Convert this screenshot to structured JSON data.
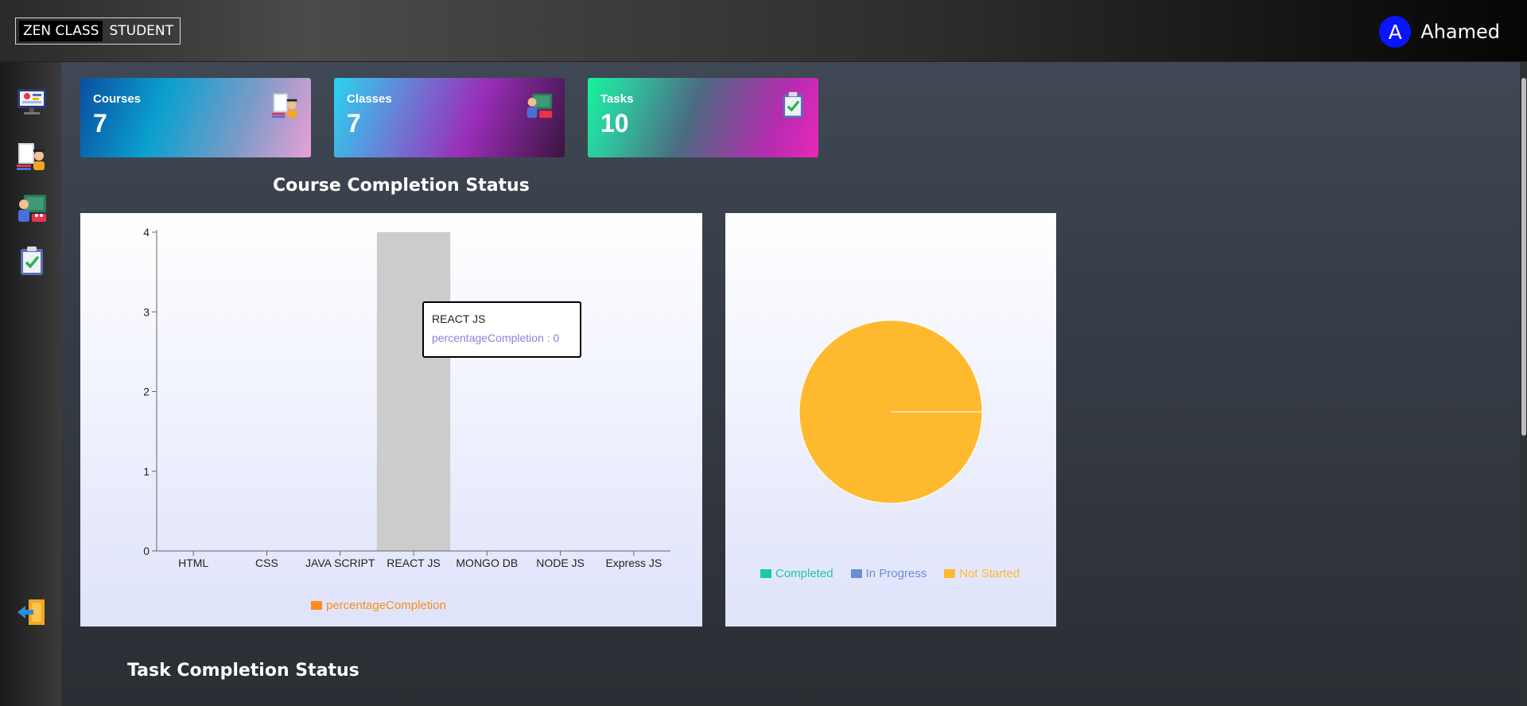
{
  "header": {
    "logo_part1": "ZEN CLASS",
    "logo_part2": "STUDENT",
    "avatar_letter": "A",
    "username": "Ahamed",
    "avatar_color": "#0a14ff"
  },
  "sidebar": {
    "items": [
      {
        "name": "dashboard",
        "icon": "dashboard-monitor-icon"
      },
      {
        "name": "courses",
        "icon": "books-student-icon"
      },
      {
        "name": "classes",
        "icon": "teacher-board-icon"
      },
      {
        "name": "tasks",
        "icon": "clipboard-check-icon"
      },
      {
        "name": "logout",
        "icon": "logout-icon"
      }
    ]
  },
  "stats": {
    "courses": {
      "label": "Courses",
      "value": "7",
      "icon": "books-student-icon"
    },
    "classes": {
      "label": "Classes",
      "value": "7",
      "icon": "teacher-board-icon"
    },
    "tasks": {
      "label": "Tasks",
      "value": "10",
      "icon": "clipboard-check-icon"
    }
  },
  "sections": {
    "course_completion": "Course Completion Status",
    "task_completion": "Task Completion Status"
  },
  "tooltip": {
    "name": "REACT JS",
    "value": "percentageCompletion : 0"
  },
  "chart_data": [
    {
      "type": "bar",
      "categories": [
        "HTML",
        "CSS",
        "JAVA SCRIPT",
        "REACT JS",
        "MONGO DB",
        "NODE JS",
        "Express JS"
      ],
      "series": [
        {
          "name": "percentageCompletion",
          "values": [
            0,
            0,
            0,
            0,
            0,
            0,
            0
          ],
          "color": "#ff8c1a"
        }
      ],
      "yticks": [
        0,
        1,
        2,
        3,
        4
      ],
      "ylim": [
        0,
        4
      ],
      "highlighted_category": "REACT JS",
      "legend_position": "bottom"
    },
    {
      "type": "pie",
      "labels": [
        "Completed",
        "In Progress",
        "Not Started"
      ],
      "values": [
        0,
        0,
        10
      ],
      "colors": [
        "#1ec8a5",
        "#6a8ed6",
        "#ffb92e"
      ],
      "legend_position": "bottom"
    }
  ]
}
